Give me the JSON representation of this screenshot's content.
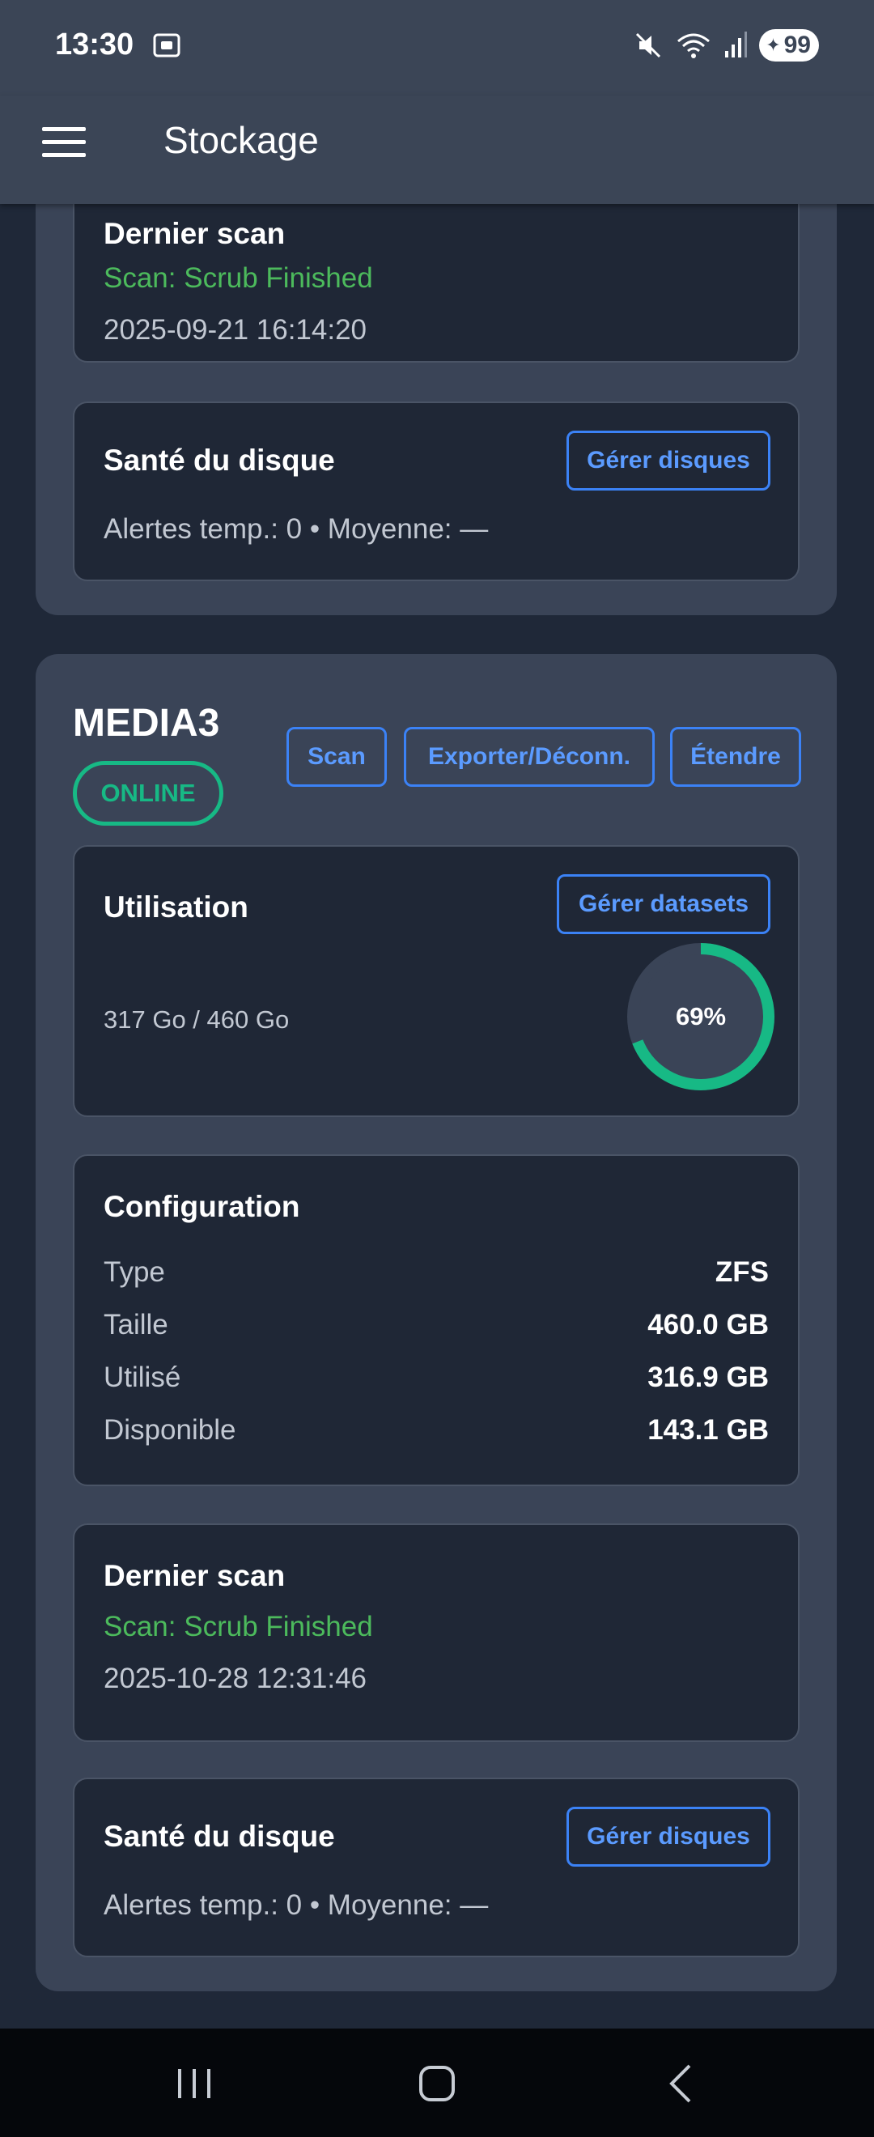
{
  "status_bar": {
    "time": "13:30",
    "battery": "99",
    "icons": [
      "screenshot-icon",
      "mute-icon",
      "wifi-icon",
      "signal-icon",
      "battery-icon"
    ]
  },
  "app_bar": {
    "title": "Stockage",
    "menu_icon": "hamburger-menu-icon"
  },
  "pool_1": {
    "last_scan": {
      "title": "Dernier scan",
      "status": "Scan: Scrub Finished",
      "timestamp": "2025-09-21 16:14:20"
    },
    "disk_health": {
      "title": "Santé du disque",
      "button": "Gérer disques",
      "alerts": "Alertes temp.: 0 • Moyenne: —"
    }
  },
  "pool_2": {
    "name": "MEDIA3",
    "status": "ONLINE",
    "actions": {
      "scan": "Scan",
      "export": "Exporter/Déconn.",
      "extend": "Étendre"
    },
    "usage": {
      "title": "Utilisation",
      "button": "Gérer datasets",
      "text": "317 Go / 460 Go",
      "percent_label": "69%",
      "percent": 69
    },
    "configuration": {
      "title": "Configuration",
      "rows": [
        {
          "label": "Type",
          "value": "ZFS"
        },
        {
          "label": "Taille",
          "value": "460.0 GB"
        },
        {
          "label": "Utilisé",
          "value": "316.9 GB"
        },
        {
          "label": "Disponible",
          "value": "143.1 GB"
        }
      ]
    },
    "last_scan": {
      "title": "Dernier scan",
      "status": "Scan: Scrub Finished",
      "timestamp": "2025-10-28 12:31:46"
    },
    "disk_health": {
      "title": "Santé du disque",
      "button": "Gérer disques",
      "alerts": "Alertes temp.: 0 • Moyenne: —"
    }
  },
  "colors": {
    "accent_blue": "#3b82f6",
    "online_green": "#17b985",
    "scan_green": "#4cba5c",
    "card_bg": "#1f2736",
    "pool_bg": "#3a4457"
  }
}
